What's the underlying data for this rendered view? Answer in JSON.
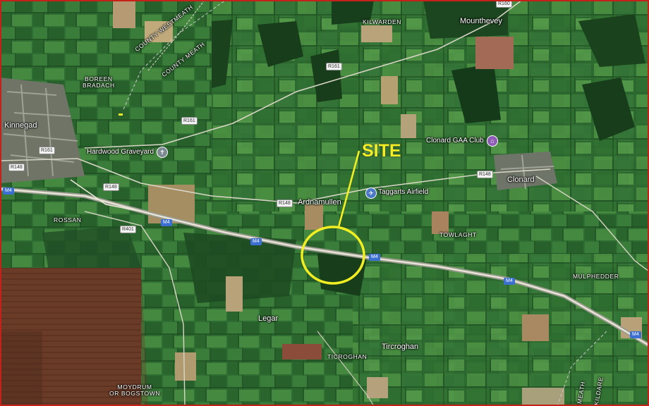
{
  "map": {
    "type": "satellite",
    "annotation": {
      "title": "SITE",
      "color": "#f2ee22"
    },
    "places": {
      "kinnegad": "Kinnegad",
      "boreen_bradach": "BOREEN\nBRADACH",
      "kilwarden": "KILWARDEN",
      "mounthevey": "Mounthevey",
      "ardnamullen": "Ardnamullen",
      "clonard": "Clonard",
      "rossan": "ROSSAN",
      "towlaght": "TOWLAGHT",
      "mulphedder": "MULPHEDDER",
      "legar": "Legar",
      "ticroghan_area": "TICROGHAN",
      "tircroghan": "Tircroghan",
      "moydrum": "MOYDRUM\nOR BOGSTOWN",
      "county_westmeath": "COUNTY WESTMEATH",
      "county_meath": "COUNTY MEATH",
      "meath": "MEATH",
      "kildare": "KILDARE"
    },
    "pois": {
      "graveyard": {
        "label": "Hardwood Graveyard",
        "icon": "graveyard-icon"
      },
      "airfield": {
        "label": "Taggarts Airfield",
        "icon": "airplane-icon"
      },
      "gaa": {
        "label": "Clonard GAA Club",
        "icon": "stadium-icon"
      }
    },
    "roads": {
      "r161_a": "R161",
      "r161_b": "R161",
      "r161_c": "R161",
      "r148_a": "R148",
      "r148_b": "R148",
      "r148_c": "R148",
      "r148_d": "R148",
      "r401": "R401",
      "m4_a": "M4",
      "m4_b": "M4",
      "m4_c": "M4",
      "m4_d": "M4",
      "m4_e": "M4",
      "m4_f": "M4",
      "r160": "R160"
    },
    "colors": {
      "frame": "#c6201b",
      "site": "#f2ee22",
      "motorway": "#3b6fd1"
    }
  }
}
